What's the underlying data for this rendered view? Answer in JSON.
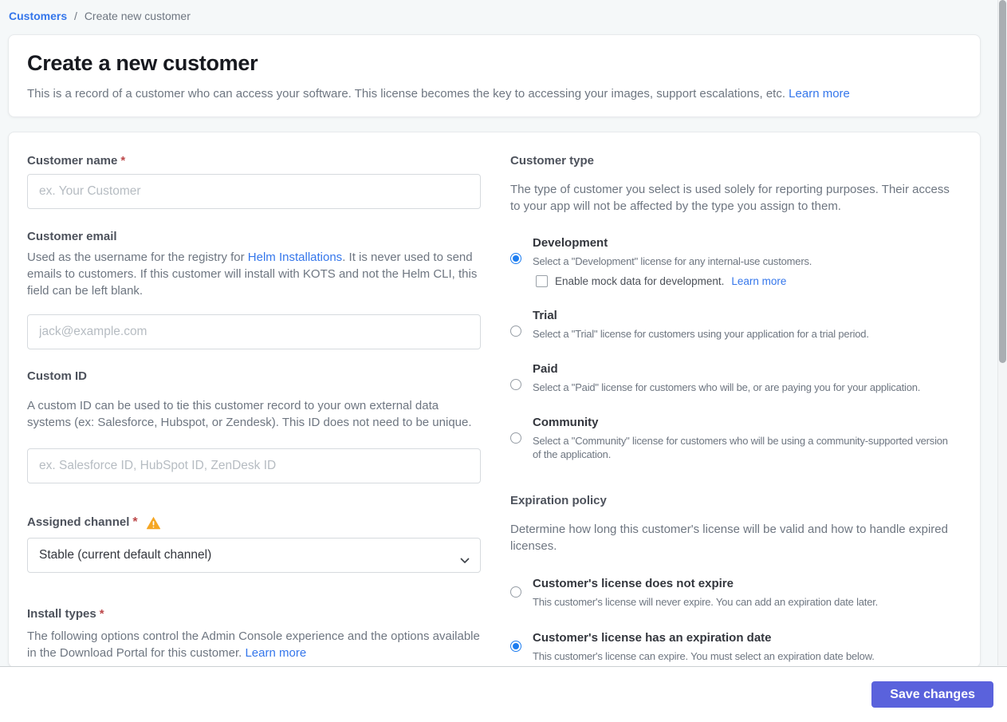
{
  "breadcrumb": {
    "link": "Customers",
    "separator": "/",
    "current": "Create new customer"
  },
  "header": {
    "title": "Create a new customer",
    "description": "This is a record of a customer who can access your software. This license becomes the key to accessing your images, support escalations, etc.",
    "learn_more": "Learn more"
  },
  "form": {
    "customer_name": {
      "label": "Customer name",
      "required": "*",
      "placeholder": "ex. Your Customer",
      "value": ""
    },
    "customer_email": {
      "label": "Customer email",
      "help_prefix": "Used as the username for the registry for ",
      "help_link": "Helm Installations",
      "help_suffix": ". It is never used to send emails to customers. If this customer will install with KOTS and not the Helm CLI, this field can be left blank.",
      "placeholder": "jack@example.com",
      "value": ""
    },
    "custom_id": {
      "label": "Custom ID",
      "help": "A custom ID can be used to tie this customer record to your own external data systems (ex: Salesforce, Hubspot, or Zendesk). This ID does not need to be unique.",
      "placeholder": "ex. Salesforce ID, HubSpot ID, ZenDesk ID",
      "value": ""
    },
    "assigned_channel": {
      "label": "Assigned channel",
      "required": "*",
      "selected_option": "Stable (current default channel)",
      "warning_icon": "warning-triangle"
    },
    "install_types": {
      "label": "Install types",
      "required": "*",
      "help": "The following options control the Admin Console experience and the options available in the Download Portal for this customer.",
      "learn_more": "Learn more"
    }
  },
  "customer_type": {
    "title": "Customer type",
    "description": "The type of customer you select is used solely for reporting purposes. Their access to your app will not be affected by the type you assign to them.",
    "options": [
      {
        "label": "Development",
        "description": "Select a \"Development\" license for any internal-use customers.",
        "selected": true,
        "checkbox": {
          "label": "Enable mock data for development.",
          "learn_more": "Learn more",
          "checked": false
        }
      },
      {
        "label": "Trial",
        "description": "Select a \"Trial\" license for customers using your application for a trial period.",
        "selected": false
      },
      {
        "label": "Paid",
        "description": "Select a \"Paid\" license for customers who will be, or are paying you for your application.",
        "selected": false
      },
      {
        "label": "Community",
        "description": "Select a \"Community\" license for customers who will be using a community-supported version of the application.",
        "selected": false
      }
    ]
  },
  "expiration_policy": {
    "title": "Expiration policy",
    "description": "Determine how long this customer's license will be valid and how to handle expired licenses.",
    "options": [
      {
        "label": "Customer's license does not expire",
        "description": "This customer's license will never expire. You can add an expiration date later.",
        "selected": false
      },
      {
        "label": "Customer's license has an expiration date",
        "description": "This customer's license can expire. You must select an expiration date below.",
        "selected": true
      }
    ]
  },
  "footer": {
    "save_label": "Save changes"
  },
  "colors": {
    "page_background": "#f5f8f9",
    "accent_link": "#3476eb",
    "radio_selected": "#1d7df0",
    "save_button_bg": "#5a62dc",
    "warning_icon": "#f5a623",
    "required_asterisk": "#bc4749",
    "title_text": "#17191f"
  }
}
